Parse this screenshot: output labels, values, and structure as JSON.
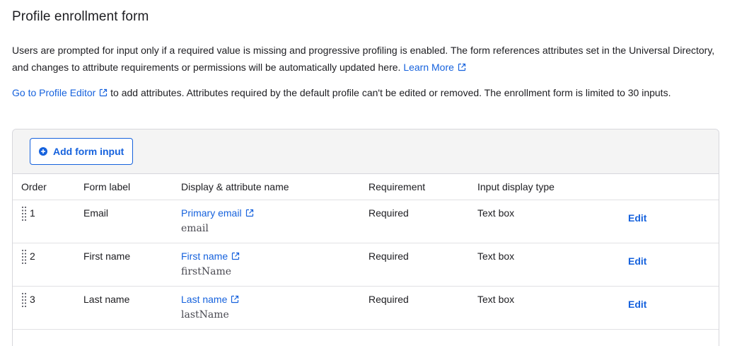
{
  "header": {
    "title": "Profile enrollment form"
  },
  "intro": {
    "text": "Users are prompted for input only if a required value is missing and progressive profiling is enabled. The form references attributes set in the Universal Directory, and changes to attribute requirements or permissions will be automatically updated here.",
    "learn_more": "Learn More"
  },
  "editor_note": {
    "link": "Go to Profile Editor",
    "text": "to add attributes. Attributes required by the default profile can't be edited or removed. The enrollment form is limited to 30 inputs."
  },
  "toolbar": {
    "add_label": "Add form input",
    "add_icon": "plus-circle-icon"
  },
  "table": {
    "headers": {
      "order": "Order",
      "label": "Form label",
      "display": "Display & attribute name",
      "requirement": "Requirement",
      "type": "Input display type"
    },
    "rows": [
      {
        "order": "1",
        "label": "Email",
        "display": "Primary email",
        "attr": "email",
        "requirement": "Required",
        "type": "Text box",
        "edit": "Edit"
      },
      {
        "order": "2",
        "label": "First name",
        "display": "First name",
        "attr": "firstName",
        "requirement": "Required",
        "type": "Text box",
        "edit": "Edit"
      },
      {
        "order": "3",
        "label": "Last name",
        "display": "Last name",
        "attr": "lastName",
        "requirement": "Required",
        "type": "Text box",
        "edit": "Edit"
      }
    ]
  },
  "colors": {
    "link": "#1662dd",
    "toolbar_bg": "#f4f4f4",
    "border": "#d7d7dc"
  }
}
